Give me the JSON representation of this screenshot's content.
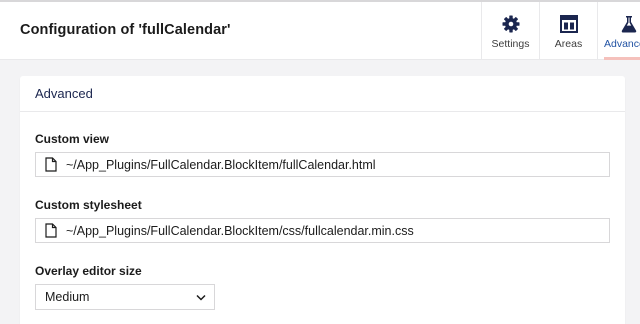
{
  "header": {
    "title": "Configuration of 'fullCalendar'",
    "tabs": [
      {
        "label": "Settings",
        "icon": "gear-icon"
      },
      {
        "label": "Areas",
        "icon": "layout-icon"
      },
      {
        "label": "Advance",
        "icon": "flask-icon",
        "active": true
      }
    ]
  },
  "panel": {
    "title": "Advanced",
    "custom_view": {
      "label": "Custom view",
      "value": "~/App_Plugins/FullCalendar.BlockItem/fullCalendar.html",
      "icon": "file-icon"
    },
    "custom_stylesheet": {
      "label": "Custom stylesheet",
      "value": "~/App_Plugins/FullCalendar.BlockItem/css/fullcalendar.min.css",
      "icon": "file-icon"
    },
    "overlay_editor_size": {
      "label": "Overlay editor size",
      "value": "Medium"
    }
  },
  "colors": {
    "header_text": "#1b1b1b",
    "active_tab_label": "#2152a3",
    "active_tab_underline": "#f5c1bc",
    "background": "#f3f3f5"
  }
}
